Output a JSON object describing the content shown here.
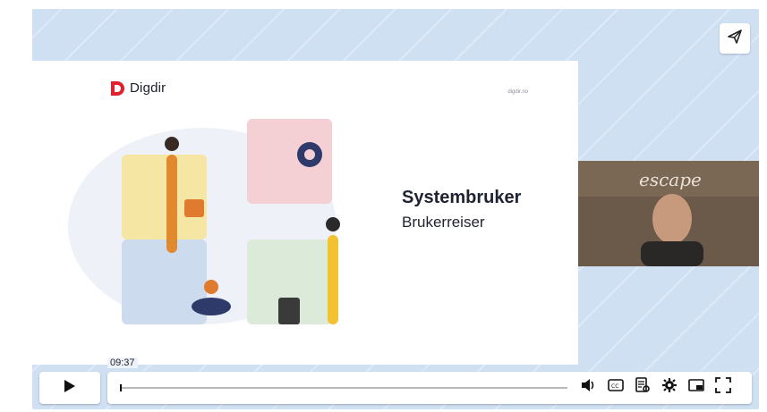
{
  "slide": {
    "logo_text": "Digdir",
    "site_text": "digdir.no",
    "title": "Systembruker",
    "subtitle": "Brukerreiser"
  },
  "camera": {
    "sign_text": "escape"
  },
  "player": {
    "current_time": "09:37",
    "progress": 0.0
  },
  "icons": {
    "share": "share-icon",
    "play": "play-icon",
    "volume": "volume-icon",
    "captions": "closed-captions-icon",
    "transcript": "transcript-icon",
    "settings": "gear-icon",
    "pip": "picture-in-picture-icon",
    "fullscreen": "fullscreen-icon"
  },
  "colors": {
    "background": "#cfe0f3",
    "brand_red": "#e0202e",
    "control_bg": "#ffffff"
  }
}
